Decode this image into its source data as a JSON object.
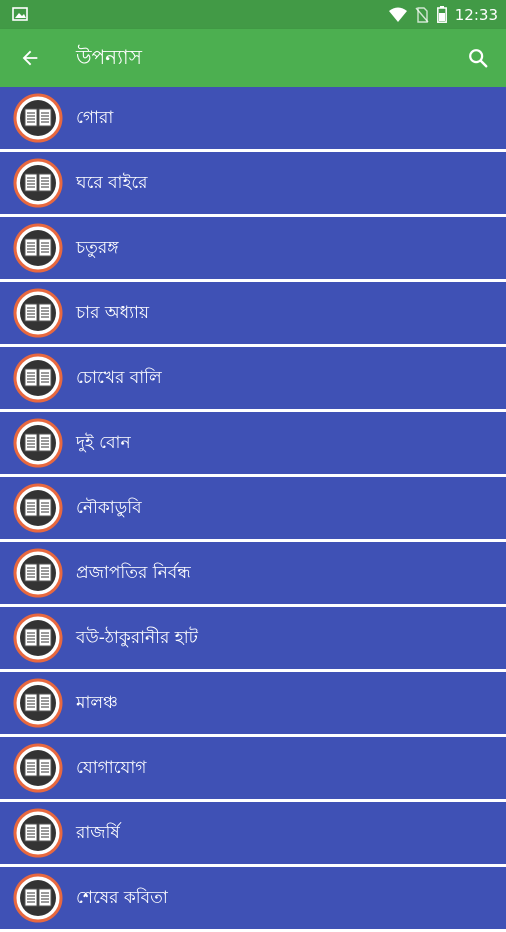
{
  "status_bar": {
    "time": "12:33",
    "icons": [
      "image-icon",
      "wifi-icon",
      "no-sim-icon",
      "battery-icon"
    ]
  },
  "app_bar": {
    "title": "উপন্যাস",
    "back_icon": "arrow-back-icon",
    "search_icon": "search-icon"
  },
  "colors": {
    "status_bar": "#429a46",
    "app_bar": "#4caf50",
    "list_item_bg": "#3f51b5",
    "divider": "#ffffff",
    "icon_ring": "#e8683f"
  },
  "items": [
    {
      "label": "গোরা"
    },
    {
      "label": "ঘরে বাইরে"
    },
    {
      "label": "চতুরঙ্গ"
    },
    {
      "label": "চার অধ্যায়"
    },
    {
      "label": "চোখের বালি"
    },
    {
      "label": "দুই বোন"
    },
    {
      "label": "নৌকাডুবি"
    },
    {
      "label": "প্রজাপতির নির্বন্ধ"
    },
    {
      "label": "বউ-ঠাকুরানীর হাট"
    },
    {
      "label": "মালঞ্চ"
    },
    {
      "label": "যোগাযোগ"
    },
    {
      "label": "রাজর্ষি"
    },
    {
      "label": "শেষের কবিতা"
    }
  ]
}
